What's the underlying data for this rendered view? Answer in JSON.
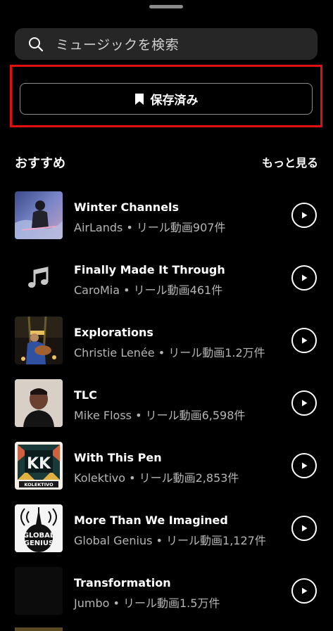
{
  "search": {
    "placeholder": "ミュージックを検索"
  },
  "saved_button": {
    "label": "保存済み"
  },
  "section": {
    "title": "おすすめ",
    "see_more": "もっと見る"
  },
  "tracks": [
    {
      "title": "Winter Channels",
      "subtitle": "AirLands • リール動画907件"
    },
    {
      "title": "Finally Made It Through",
      "subtitle": "CaroMia • リール動画461件"
    },
    {
      "title": "Explorations",
      "subtitle": "Christie Lenée • リール動画1.2万件"
    },
    {
      "title": "TLC",
      "subtitle": "Mike Floss • リール動画6,598件"
    },
    {
      "title": "With This Pen",
      "subtitle": "Kolektivo • リール動画2,853件"
    },
    {
      "title": "More Than We Imagined",
      "subtitle": "Global Genius • リール動画1,127件"
    },
    {
      "title": "Transformation",
      "subtitle": "Jumbo • リール動画1.5万件"
    }
  ],
  "artwork_text": {
    "kolektivo": "KOLEKTIVO",
    "global_genius_1": "GLOBAL",
    "global_genius_2": "GENIUS"
  },
  "colors": {
    "background": "#000000",
    "search_bg": "#262626",
    "highlight": "#e01010",
    "subtitle": "#b5b5b5"
  }
}
